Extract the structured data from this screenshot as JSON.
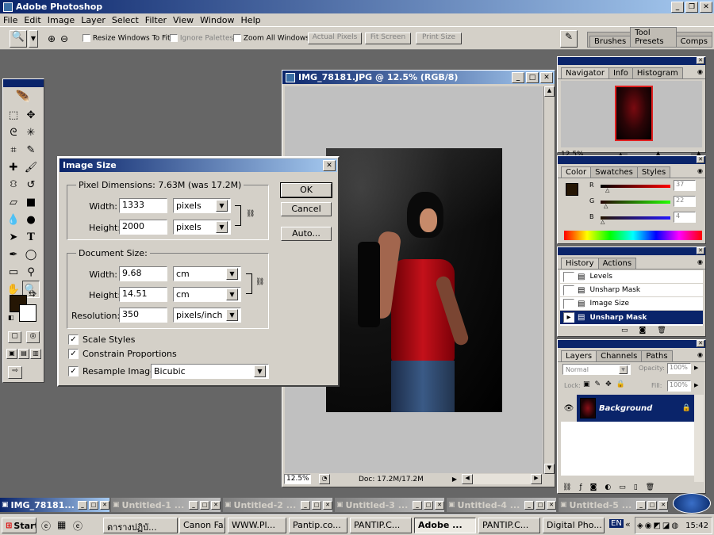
{
  "app": {
    "title": "Adobe Photoshop"
  },
  "menu": [
    "File",
    "Edit",
    "Image",
    "Layer",
    "Select",
    "Filter",
    "View",
    "Window",
    "Help"
  ],
  "options": {
    "resize": "Resize Windows To Fit",
    "ignore": "Ignore Palettes",
    "zoomall": "Zoom All Windows",
    "actual": "Actual Pixels",
    "fit": "Fit Screen",
    "print": "Print Size"
  },
  "well": {
    "brushes": "Brushes",
    "presets": "Tool Presets",
    "comps": "Comps"
  },
  "doc": {
    "title": "IMG_78181.JPG @ 12.5% (RGB/8)",
    "zoom": "12.5%",
    "info": "Doc: 17.2M/17.2M"
  },
  "dialog": {
    "title": "Image Size",
    "pixel_dim": "Pixel Dimensions:  7.63M (was 17.2M)",
    "width_label": "Width:",
    "width": "1333",
    "width_unit": "pixels",
    "height_label": "Height:",
    "height": "2000",
    "height_unit": "pixels",
    "doc_size": "Document Size:",
    "dwidth_label": "Width:",
    "dwidth": "9.68",
    "dwidth_unit": "cm",
    "dheight_label": "Height:",
    "dheight": "14.51",
    "dheight_unit": "cm",
    "res_label": "Resolution:",
    "res": "350",
    "res_unit": "pixels/inch",
    "scale": "Scale Styles",
    "constrain": "Constrain Proportions",
    "resample": "Resample Image:",
    "resample_val": "Bicubic",
    "ok": "OK",
    "cancel": "Cancel",
    "auto": "Auto..."
  },
  "navigator": {
    "tabs": [
      "Navigator",
      "Info",
      "Histogram"
    ],
    "zoom": "12.5%"
  },
  "color": {
    "tabs": [
      "Color",
      "Swatches",
      "Styles"
    ],
    "r_label": "R",
    "g_label": "G",
    "b_label": "B",
    "r": "37",
    "g": "22",
    "b": "4",
    "fg": "#251604"
  },
  "history": {
    "tabs": [
      "History",
      "Actions"
    ],
    "items": [
      "Levels",
      "Unsharp Mask",
      "Image Size",
      "Unsharp Mask"
    ]
  },
  "layers": {
    "tabs": [
      "Layers",
      "Channels",
      "Paths"
    ],
    "mode": "Normal",
    "opacity_label": "Opacity:",
    "opacity": "100%",
    "lock_label": "Lock:",
    "fill_label": "Fill:",
    "fill": "100%",
    "layer": "Background"
  },
  "minimized": [
    {
      "title": "IMG_78181..."
    },
    {
      "title": "Untitled-1 ..."
    },
    {
      "title": "Untitled-2 ..."
    },
    {
      "title": "Untitled-3 ..."
    },
    {
      "title": "Untitled-4 ..."
    },
    {
      "title": "Untitled-5 ..."
    }
  ],
  "taskbar": {
    "start": "Start",
    "items": [
      "ตารางปฏิบั...",
      "Canon Fa...",
      "WWW.Pl...",
      "Pantip.co...",
      "PANTIP.C...",
      "Adobe ...",
      "PANTIP.C...",
      "Digital Pho..."
    ],
    "lang": "EN",
    "time": "15:42"
  }
}
